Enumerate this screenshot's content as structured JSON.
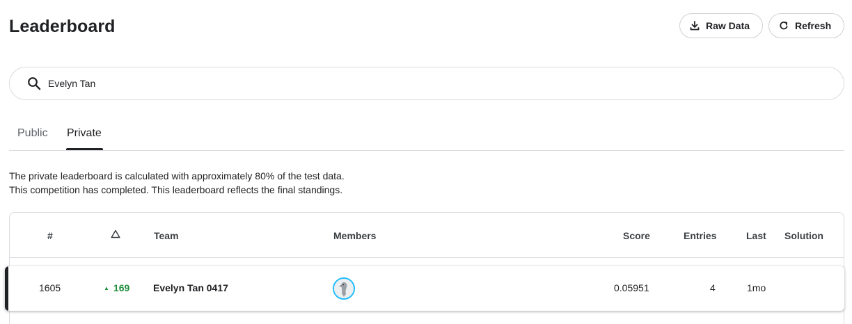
{
  "header": {
    "title": "Leaderboard",
    "raw_data_label": "Raw Data",
    "refresh_label": "Refresh"
  },
  "search": {
    "value": "Evelyn Tan",
    "icon": "search-icon"
  },
  "tabs": [
    {
      "label": "Public",
      "active": false
    },
    {
      "label": "Private",
      "active": true
    }
  ],
  "info": {
    "line1": "The private leaderboard is calculated with approximately 80% of the test data.",
    "line2": "This competition has completed. This leaderboard reflects the final standings."
  },
  "table": {
    "columns": {
      "rank": "#",
      "team": "Team",
      "members": "Members",
      "score": "Score",
      "entries": "Entries",
      "last": "Last",
      "solution": "Solution"
    },
    "rows": [
      {
        "rank": "1605",
        "delta": "169",
        "delta_direction": "up",
        "team": "Evelyn Tan 0417",
        "score": "0.05951",
        "entries": "4",
        "last": "1mo",
        "solution": ""
      }
    ]
  },
  "colors": {
    "accent": "#20beff",
    "positive": "#1e8e3e",
    "text": "#202124"
  }
}
